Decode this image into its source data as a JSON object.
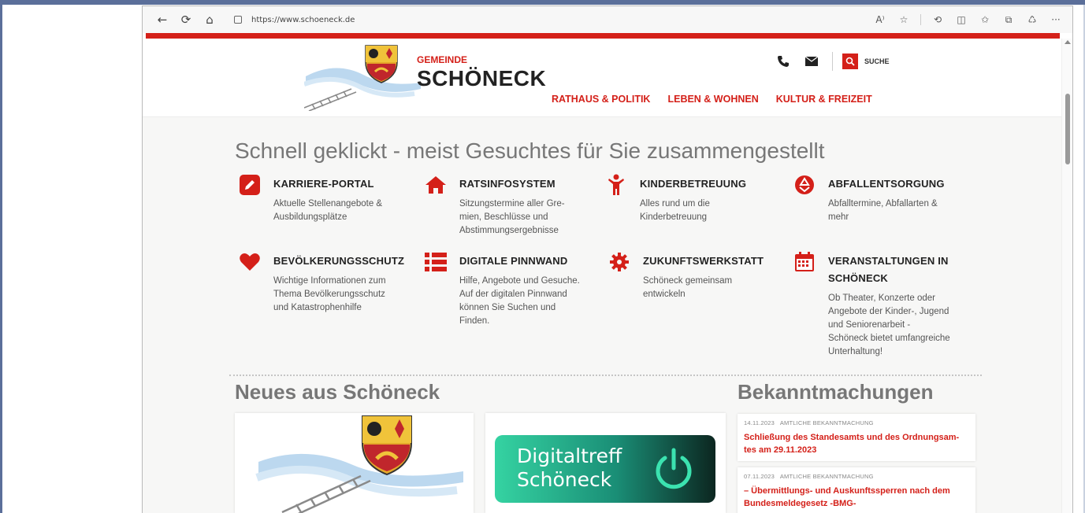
{
  "browser": {
    "url": "https://www.schoeneck.de",
    "nav_glyphs": {
      "back": "←",
      "refresh": "⟳",
      "home": "⌂"
    },
    "toolbar_glyphs": {
      "read_aloud": "A⁾",
      "favorite": "☆",
      "refresh2": "⟲",
      "split": "◫",
      "favorites": "✩",
      "collections": "⧉",
      "extensions": "♺",
      "more": "···"
    }
  },
  "site": {
    "brand_pre": "GEMEINDE",
    "brand_main": "SCHÖNECK",
    "nav": [
      "RATHAUS & POLITIK",
      "LEBEN & WOHNEN",
      "KULTUR & FREIZEIT"
    ],
    "search_label": "SUCHE",
    "accent": "#d42019"
  },
  "quick": {
    "heading": "Schnell geklickt - meist Gesuchtes für Sie zusammengestellt",
    "tiles": [
      {
        "title": "KARRIERE-PORTAL",
        "desc": [
          "Aktuelle Stellenangebote &",
          "Ausbildungsplätze"
        ],
        "icon": "pencil-icon"
      },
      {
        "title": "RATSINFOSYSTEM",
        "desc": [
          "Sitzungstermine aller Gre-",
          "mien, Beschlüsse und",
          "Abstimmungsergebnisse"
        ],
        "icon": "house-icon"
      },
      {
        "title": "KINDERBETREUUNG",
        "desc": [
          "Alles rund um die",
          "Kinderbetreuung"
        ],
        "icon": "child-icon"
      },
      {
        "title": "ABFALLENTSORGUNG",
        "desc": [
          "Abfalltermine, Abfallarten &",
          "mehr"
        ],
        "icon": "recycle-icon"
      },
      {
        "title": "BEVÖLKERUNGSSCHUTZ",
        "desc": [
          "Wichtige Informationen zum",
          "Thema Bevölkerungsschutz",
          "und Katastrophenhilfe"
        ],
        "icon": "heart-icon"
      },
      {
        "title": "DIGITALE PINNWAND",
        "desc": [
          "Hilfe, Angebote und Gesuche.",
          "Auf der digitalen Pinnwand",
          "können Sie Suchen und",
          "Finden."
        ],
        "icon": "list-icon"
      },
      {
        "title": "ZUKUNFTSWERKSTATT",
        "desc": [
          "Schöneck gemeinsam",
          "entwickeln"
        ],
        "icon": "gear-icon"
      },
      {
        "title": "VERANSTALTUNGEN IN",
        "title2": "SCHÖNECK",
        "desc": [
          "Ob Theater, Konzerte oder",
          "Angebote der Kinder-, Jugend",
          "und Seniorenarbeit -",
          "Schöneck bietet umfangreiche",
          "Unterhaltung!"
        ],
        "icon": "calendar-icon"
      }
    ]
  },
  "news": {
    "heading": "Neues aus Schöneck",
    "digital_line1": "Digitaltreff",
    "digital_line2": "Schöneck"
  },
  "announcements": {
    "heading": "Bekanntmachungen",
    "items": [
      {
        "date": "14.11.2023",
        "type": "AMTLICHE BEKANNTMACHUNG",
        "title_line1": "Schließung des Standesamts und des Ordnungsam-",
        "title_line2": "tes am 29.11.2023"
      },
      {
        "date": "07.11.2023",
        "type": "AMTLICHE BEKANNTMACHUNG",
        "title_line1": "– Übermittlungs- und Auskunftssperren nach dem",
        "title_line2": "Bundesmeldegesetz -BMG-"
      }
    ]
  }
}
